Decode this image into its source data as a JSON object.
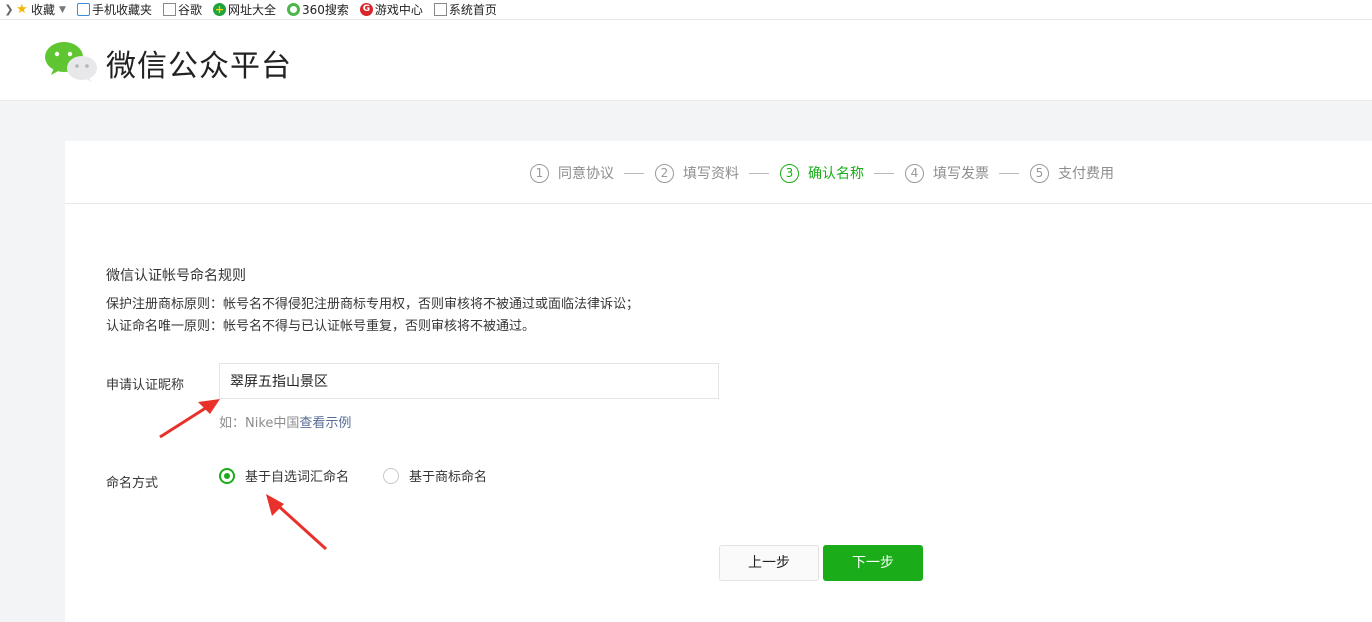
{
  "bookmarks": [
    {
      "label": "收藏",
      "icon": "star-icon"
    },
    {
      "label": "手机收藏夹",
      "icon": "phone-icon"
    },
    {
      "label": "谷歌",
      "icon": "page-icon"
    },
    {
      "label": "网址大全",
      "icon": "green-plus-icon"
    },
    {
      "label": "360搜索",
      "icon": "360-icon"
    },
    {
      "label": "游戏中心",
      "icon": "game-icon"
    },
    {
      "label": "系统首页",
      "icon": "page-icon"
    }
  ],
  "header": {
    "title": "微信公众平台"
  },
  "steps": [
    {
      "num": "1",
      "label": "同意协议",
      "active": false
    },
    {
      "num": "2",
      "label": "填写资料",
      "active": false
    },
    {
      "num": "3",
      "label": "确认名称",
      "active": true
    },
    {
      "num": "4",
      "label": "填写发票",
      "active": false
    },
    {
      "num": "5",
      "label": "支付费用",
      "active": false
    }
  ],
  "rules": {
    "title": "微信认证帐号命名规则",
    "line1": "保护注册商标原则：帐号名不得侵犯注册商标专用权，否则审核将不被通过或面临法律诉讼；",
    "line2": "认证命名唯一原则：帐号名不得与已认证帐号重复，否则审核将不被通过。"
  },
  "form": {
    "name_label": "申请认证昵称",
    "name_value": "翠屏五指山景区",
    "hint_prefix": "如：Nike中国",
    "hint_link": "查看示例",
    "method_label": "命名方式",
    "option_vocab": "基于自选词汇命名",
    "option_trademark": "基于商标命名",
    "selected": "vocab"
  },
  "buttons": {
    "prev": "上一步",
    "next": "下一步"
  },
  "colors": {
    "accent": "#1aad19",
    "annotation": "#e8312a",
    "link": "#576b95"
  }
}
